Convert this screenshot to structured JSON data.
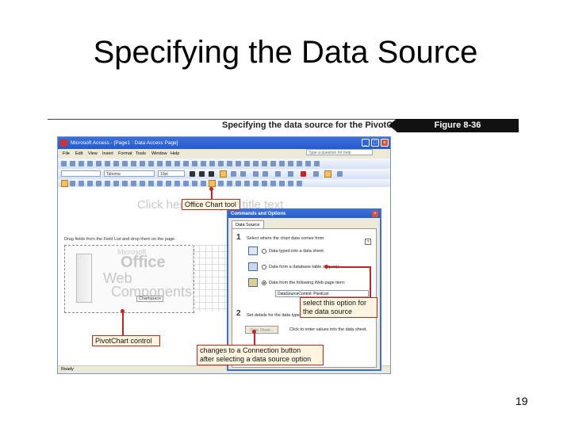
{
  "slide": {
    "title": "Specifying the Data Source",
    "number": "19"
  },
  "figure": {
    "caption": "Specifying the data source for the PivotChart",
    "label": "Figure 8-36"
  },
  "window": {
    "title": "Microsoft Access - [Page1 : Data Access Page]",
    "menu": [
      "File",
      "Edit",
      "View",
      "Insert",
      "Format",
      "Tools",
      "Window",
      "Help"
    ],
    "ask_placeholder": "Type a question for help",
    "font_name": "Tahoma",
    "font_size": "10pt",
    "status": "Ready"
  },
  "canvas": {
    "title_placeholder": "Click here and type title text",
    "drag_instruction": "Drag fields from the Field List and drop them on the page.",
    "logo_line1": "Microsoft",
    "logo_line2": "Office",
    "logo_line3": "Web",
    "logo_line4": "Components",
    "chartspace_label": "Chartspace"
  },
  "dialog": {
    "title": "Commands and Options",
    "tab": "Data Source",
    "step1_num": "1",
    "step1_text": "Select where the chart data comes from:",
    "option1": "Data typed into a data sheet.",
    "option2": "Data from a database table or query.",
    "option3": "Data from the following Web page item:",
    "url_value": "DataSourceControl: PivotList",
    "step2_num": "2",
    "step2_text": "Set details for the data type",
    "sheet_button": "Data Sheet...",
    "sheet_hint": "Click to enter values into the data sheet."
  },
  "callouts": {
    "office_chart_tool": "Office Chart tool",
    "pivotchart_control": "PivotChart control",
    "select_option_line1": "select this option for",
    "select_option_line2": "the data source",
    "connection_line1": "changes to a Connection button",
    "connection_line2": "after selecting a data source option"
  },
  "colors": {
    "callout_border": "#c2261f",
    "titlebar": "#245bd0"
  }
}
